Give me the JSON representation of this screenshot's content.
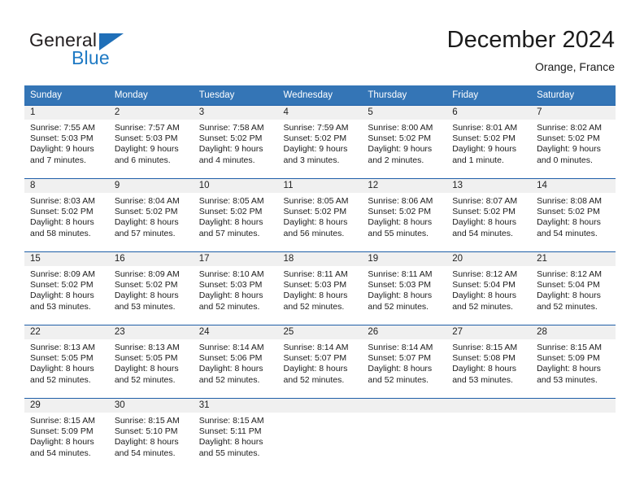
{
  "brand": {
    "name_top": "General",
    "name_bottom": "Blue",
    "triangle_color": "#1f6fb8",
    "top_color": "#231f20",
    "bottom_color": "#1f7ac4"
  },
  "header": {
    "title": "December 2024",
    "location": "Orange, France"
  },
  "colors": {
    "header_bg": "#3475b6",
    "header_text": "#ffffff",
    "row_rule": "#1f5fa8",
    "daynum_band": "#f0f0f0",
    "body_text": "#1c1c1c"
  },
  "weekdays": [
    "Sunday",
    "Monday",
    "Tuesday",
    "Wednesday",
    "Thursday",
    "Friday",
    "Saturday"
  ],
  "weeks": [
    [
      {
        "day": "1",
        "sunrise": "Sunrise: 7:55 AM",
        "sunset": "Sunset: 5:03 PM",
        "daylight1": "Daylight: 9 hours",
        "daylight2": "and 7 minutes."
      },
      {
        "day": "2",
        "sunrise": "Sunrise: 7:57 AM",
        "sunset": "Sunset: 5:03 PM",
        "daylight1": "Daylight: 9 hours",
        "daylight2": "and 6 minutes."
      },
      {
        "day": "3",
        "sunrise": "Sunrise: 7:58 AM",
        "sunset": "Sunset: 5:02 PM",
        "daylight1": "Daylight: 9 hours",
        "daylight2": "and 4 minutes."
      },
      {
        "day": "4",
        "sunrise": "Sunrise: 7:59 AM",
        "sunset": "Sunset: 5:02 PM",
        "daylight1": "Daylight: 9 hours",
        "daylight2": "and 3 minutes."
      },
      {
        "day": "5",
        "sunrise": "Sunrise: 8:00 AM",
        "sunset": "Sunset: 5:02 PM",
        "daylight1": "Daylight: 9 hours",
        "daylight2": "and 2 minutes."
      },
      {
        "day": "6",
        "sunrise": "Sunrise: 8:01 AM",
        "sunset": "Sunset: 5:02 PM",
        "daylight1": "Daylight: 9 hours",
        "daylight2": "and 1 minute."
      },
      {
        "day": "7",
        "sunrise": "Sunrise: 8:02 AM",
        "sunset": "Sunset: 5:02 PM",
        "daylight1": "Daylight: 9 hours",
        "daylight2": "and 0 minutes."
      }
    ],
    [
      {
        "day": "8",
        "sunrise": "Sunrise: 8:03 AM",
        "sunset": "Sunset: 5:02 PM",
        "daylight1": "Daylight: 8 hours",
        "daylight2": "and 58 minutes."
      },
      {
        "day": "9",
        "sunrise": "Sunrise: 8:04 AM",
        "sunset": "Sunset: 5:02 PM",
        "daylight1": "Daylight: 8 hours",
        "daylight2": "and 57 minutes."
      },
      {
        "day": "10",
        "sunrise": "Sunrise: 8:05 AM",
        "sunset": "Sunset: 5:02 PM",
        "daylight1": "Daylight: 8 hours",
        "daylight2": "and 57 minutes."
      },
      {
        "day": "11",
        "sunrise": "Sunrise: 8:05 AM",
        "sunset": "Sunset: 5:02 PM",
        "daylight1": "Daylight: 8 hours",
        "daylight2": "and 56 minutes."
      },
      {
        "day": "12",
        "sunrise": "Sunrise: 8:06 AM",
        "sunset": "Sunset: 5:02 PM",
        "daylight1": "Daylight: 8 hours",
        "daylight2": "and 55 minutes."
      },
      {
        "day": "13",
        "sunrise": "Sunrise: 8:07 AM",
        "sunset": "Sunset: 5:02 PM",
        "daylight1": "Daylight: 8 hours",
        "daylight2": "and 54 minutes."
      },
      {
        "day": "14",
        "sunrise": "Sunrise: 8:08 AM",
        "sunset": "Sunset: 5:02 PM",
        "daylight1": "Daylight: 8 hours",
        "daylight2": "and 54 minutes."
      }
    ],
    [
      {
        "day": "15",
        "sunrise": "Sunrise: 8:09 AM",
        "sunset": "Sunset: 5:02 PM",
        "daylight1": "Daylight: 8 hours",
        "daylight2": "and 53 minutes."
      },
      {
        "day": "16",
        "sunrise": "Sunrise: 8:09 AM",
        "sunset": "Sunset: 5:02 PM",
        "daylight1": "Daylight: 8 hours",
        "daylight2": "and 53 minutes."
      },
      {
        "day": "17",
        "sunrise": "Sunrise: 8:10 AM",
        "sunset": "Sunset: 5:03 PM",
        "daylight1": "Daylight: 8 hours",
        "daylight2": "and 52 minutes."
      },
      {
        "day": "18",
        "sunrise": "Sunrise: 8:11 AM",
        "sunset": "Sunset: 5:03 PM",
        "daylight1": "Daylight: 8 hours",
        "daylight2": "and 52 minutes."
      },
      {
        "day": "19",
        "sunrise": "Sunrise: 8:11 AM",
        "sunset": "Sunset: 5:03 PM",
        "daylight1": "Daylight: 8 hours",
        "daylight2": "and 52 minutes."
      },
      {
        "day": "20",
        "sunrise": "Sunrise: 8:12 AM",
        "sunset": "Sunset: 5:04 PM",
        "daylight1": "Daylight: 8 hours",
        "daylight2": "and 52 minutes."
      },
      {
        "day": "21",
        "sunrise": "Sunrise: 8:12 AM",
        "sunset": "Sunset: 5:04 PM",
        "daylight1": "Daylight: 8 hours",
        "daylight2": "and 52 minutes."
      }
    ],
    [
      {
        "day": "22",
        "sunrise": "Sunrise: 8:13 AM",
        "sunset": "Sunset: 5:05 PM",
        "daylight1": "Daylight: 8 hours",
        "daylight2": "and 52 minutes."
      },
      {
        "day": "23",
        "sunrise": "Sunrise: 8:13 AM",
        "sunset": "Sunset: 5:05 PM",
        "daylight1": "Daylight: 8 hours",
        "daylight2": "and 52 minutes."
      },
      {
        "day": "24",
        "sunrise": "Sunrise: 8:14 AM",
        "sunset": "Sunset: 5:06 PM",
        "daylight1": "Daylight: 8 hours",
        "daylight2": "and 52 minutes."
      },
      {
        "day": "25",
        "sunrise": "Sunrise: 8:14 AM",
        "sunset": "Sunset: 5:07 PM",
        "daylight1": "Daylight: 8 hours",
        "daylight2": "and 52 minutes."
      },
      {
        "day": "26",
        "sunrise": "Sunrise: 8:14 AM",
        "sunset": "Sunset: 5:07 PM",
        "daylight1": "Daylight: 8 hours",
        "daylight2": "and 52 minutes."
      },
      {
        "day": "27",
        "sunrise": "Sunrise: 8:15 AM",
        "sunset": "Sunset: 5:08 PM",
        "daylight1": "Daylight: 8 hours",
        "daylight2": "and 53 minutes."
      },
      {
        "day": "28",
        "sunrise": "Sunrise: 8:15 AM",
        "sunset": "Sunset: 5:09 PM",
        "daylight1": "Daylight: 8 hours",
        "daylight2": "and 53 minutes."
      }
    ],
    [
      {
        "day": "29",
        "sunrise": "Sunrise: 8:15 AM",
        "sunset": "Sunset: 5:09 PM",
        "daylight1": "Daylight: 8 hours",
        "daylight2": "and 54 minutes."
      },
      {
        "day": "30",
        "sunrise": "Sunrise: 8:15 AM",
        "sunset": "Sunset: 5:10 PM",
        "daylight1": "Daylight: 8 hours",
        "daylight2": "and 54 minutes."
      },
      {
        "day": "31",
        "sunrise": "Sunrise: 8:15 AM",
        "sunset": "Sunset: 5:11 PM",
        "daylight1": "Daylight: 8 hours",
        "daylight2": "and 55 minutes."
      },
      {
        "day": "",
        "sunrise": "",
        "sunset": "",
        "daylight1": "",
        "daylight2": ""
      },
      {
        "day": "",
        "sunrise": "",
        "sunset": "",
        "daylight1": "",
        "daylight2": ""
      },
      {
        "day": "",
        "sunrise": "",
        "sunset": "",
        "daylight1": "",
        "daylight2": ""
      },
      {
        "day": "",
        "sunrise": "",
        "sunset": "",
        "daylight1": "",
        "daylight2": ""
      }
    ]
  ]
}
